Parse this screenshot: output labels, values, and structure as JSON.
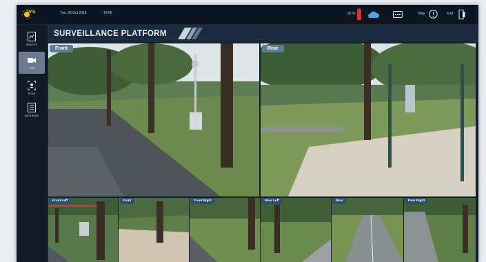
{
  "header": {
    "logo_text": "IVS",
    "date": "Tue, 26 Oct 2018",
    "time": "14:06",
    "battery_label": "92 %",
    "help_label": "Help",
    "exit_label": "Exit"
  },
  "sidebar": {
    "items": [
      {
        "label": "ROUTES",
        "icon": "routes-icon",
        "active": false
      },
      {
        "label": "CAM",
        "icon": "camera-icon",
        "active": true
      },
      {
        "label": "SCAN",
        "icon": "scan-icon",
        "active": false
      },
      {
        "label": "DATABASE",
        "icon": "database-icon",
        "active": false
      }
    ]
  },
  "main": {
    "title": "SURVEILLANCE PLATFORM",
    "large_feeds": [
      {
        "label": "Front"
      },
      {
        "label": "Rear"
      }
    ],
    "small_feeds": [
      {
        "label": "Front Left"
      },
      {
        "label": "Front"
      },
      {
        "label": "Front Right"
      },
      {
        "label": "Rear Left"
      },
      {
        "label": "Rear"
      },
      {
        "label": "Rear Right"
      }
    ]
  },
  "colors": {
    "app_background": "#141d2b",
    "active_nav": "#6b7a8f",
    "large_label_bg": "#5c7d93",
    "small_label_bg": "#2a4d70",
    "logo_accent": "#f2c417",
    "battery_red": "#e0322c",
    "cloud_blue": "#4fa3e0"
  }
}
